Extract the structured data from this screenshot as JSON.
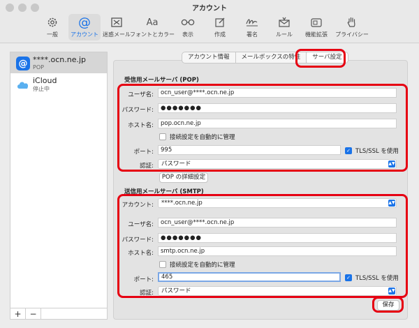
{
  "window": {
    "title": "アカウント"
  },
  "toolbar": {
    "items": [
      {
        "label": "一般",
        "icon": "gear-icon"
      },
      {
        "label": "アカウント",
        "icon": "at-icon"
      },
      {
        "label": "迷惑メール",
        "icon": "junk-tray-icon"
      },
      {
        "label": "フォントとカラー",
        "icon": "font-icon"
      },
      {
        "label": "表示",
        "icon": "glasses-icon"
      },
      {
        "label": "作成",
        "icon": "compose-icon"
      },
      {
        "label": "署名",
        "icon": "signature-icon"
      },
      {
        "label": "ルール",
        "icon": "rules-icon"
      },
      {
        "label": "機能拡張",
        "icon": "extensions-icon"
      },
      {
        "label": "プライバシー",
        "icon": "hand-icon"
      }
    ],
    "at_glyph": "@",
    "font_glyph": "Aa"
  },
  "sidebar": {
    "accounts": [
      {
        "name": "****.ocn.ne.jp",
        "sub": "POP",
        "icon_glyph": "@",
        "color": "#1a73e8"
      },
      {
        "name": "iCloud",
        "sub": "停止中",
        "color": "#5ab0f0"
      }
    ],
    "add": "+",
    "remove": "−"
  },
  "tabs": [
    "アカウント情報",
    "メールボックスの特性",
    "サーバ設定"
  ],
  "incoming": {
    "title": "受信用メールサーバ (POP)",
    "username_label": "ユーザ名:",
    "username": "ocn_user@****.ocn.ne.jp",
    "password_label": "パスワード:",
    "password": "●●●●●●●",
    "host_label": "ホスト名:",
    "host": "pop.ocn.ne.jp",
    "auto_label": "接続設定を自動的に管理",
    "port_label": "ポート:",
    "port": "995",
    "tls_label": "TLS/SSL を使用",
    "auth_label": "認証:",
    "auth": "パスワード",
    "advanced_button": "POP の詳細設定"
  },
  "outgoing": {
    "title": "送信用メールサーバ (SMTP)",
    "account_label": "アカウント:",
    "account": "****.ocn.ne.jp",
    "username_label": "ユーザ名:",
    "username": "ocn_user@****.ocn.ne.jp",
    "password_label": "パスワード:",
    "password": "●●●●●●●",
    "host_label": "ホスト名:",
    "host": "smtp.ocn.ne.jp",
    "auto_label": "接続設定を自動的に管理",
    "port_label": "ポート:",
    "port": "465",
    "tls_label": "TLS/SSL を使用",
    "auth_label": "認証:",
    "auth": "パスワード"
  },
  "save_button": "保存",
  "colors": {
    "accent": "#1a73e8",
    "highlight": "#e60012"
  },
  "checks": {
    "tick": "✓",
    "arrows": "▲▼"
  }
}
